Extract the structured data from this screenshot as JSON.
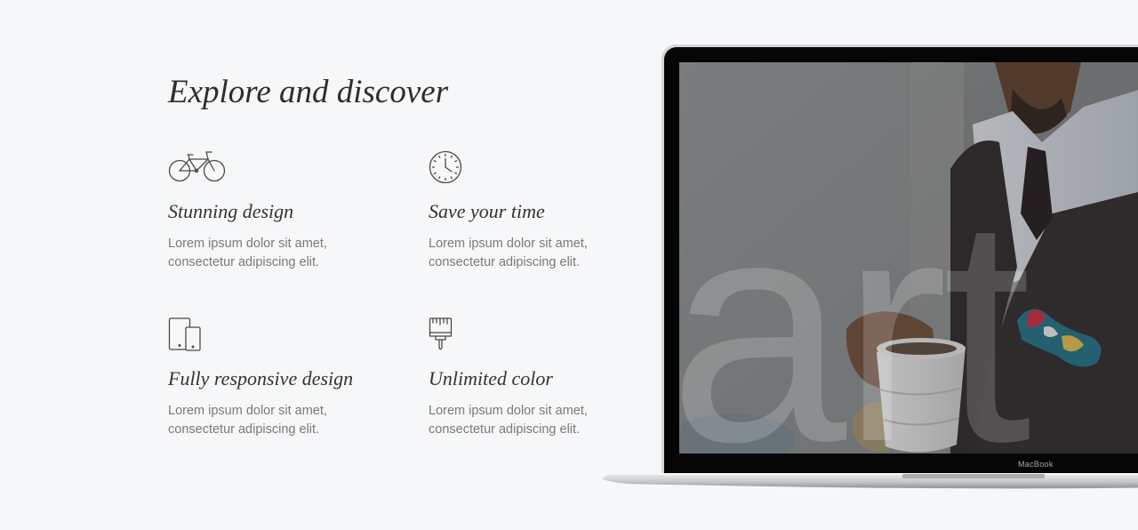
{
  "section": {
    "title": "Explore and discover"
  },
  "features": [
    {
      "icon": "bicycle-icon",
      "title": "Stunning design",
      "text": "Lorem ipsum dolor sit amet, consectetur adipiscing elit."
    },
    {
      "icon": "clock-icon",
      "title": "Save your time",
      "text": "Lorem ipsum dolor sit amet, consectetur adipiscing elit."
    },
    {
      "icon": "devices-icon",
      "title": "Fully responsive design",
      "text": "Lorem ipsum dolor sit amet, consectetur adipiscing elit."
    },
    {
      "icon": "paint-brush-icon",
      "title": "Unlimited color",
      "text": "Lorem ipsum dolor sit amet, consectetur adipiscing elit."
    }
  ],
  "laptop": {
    "brand_label": "MacBook",
    "screen_watermark": "art"
  },
  "colors": {
    "background": "#f6f7f9",
    "heading": "#2d2d2d",
    "body_text": "#7a7a7a",
    "icon_stroke": "#4a4a4a"
  }
}
